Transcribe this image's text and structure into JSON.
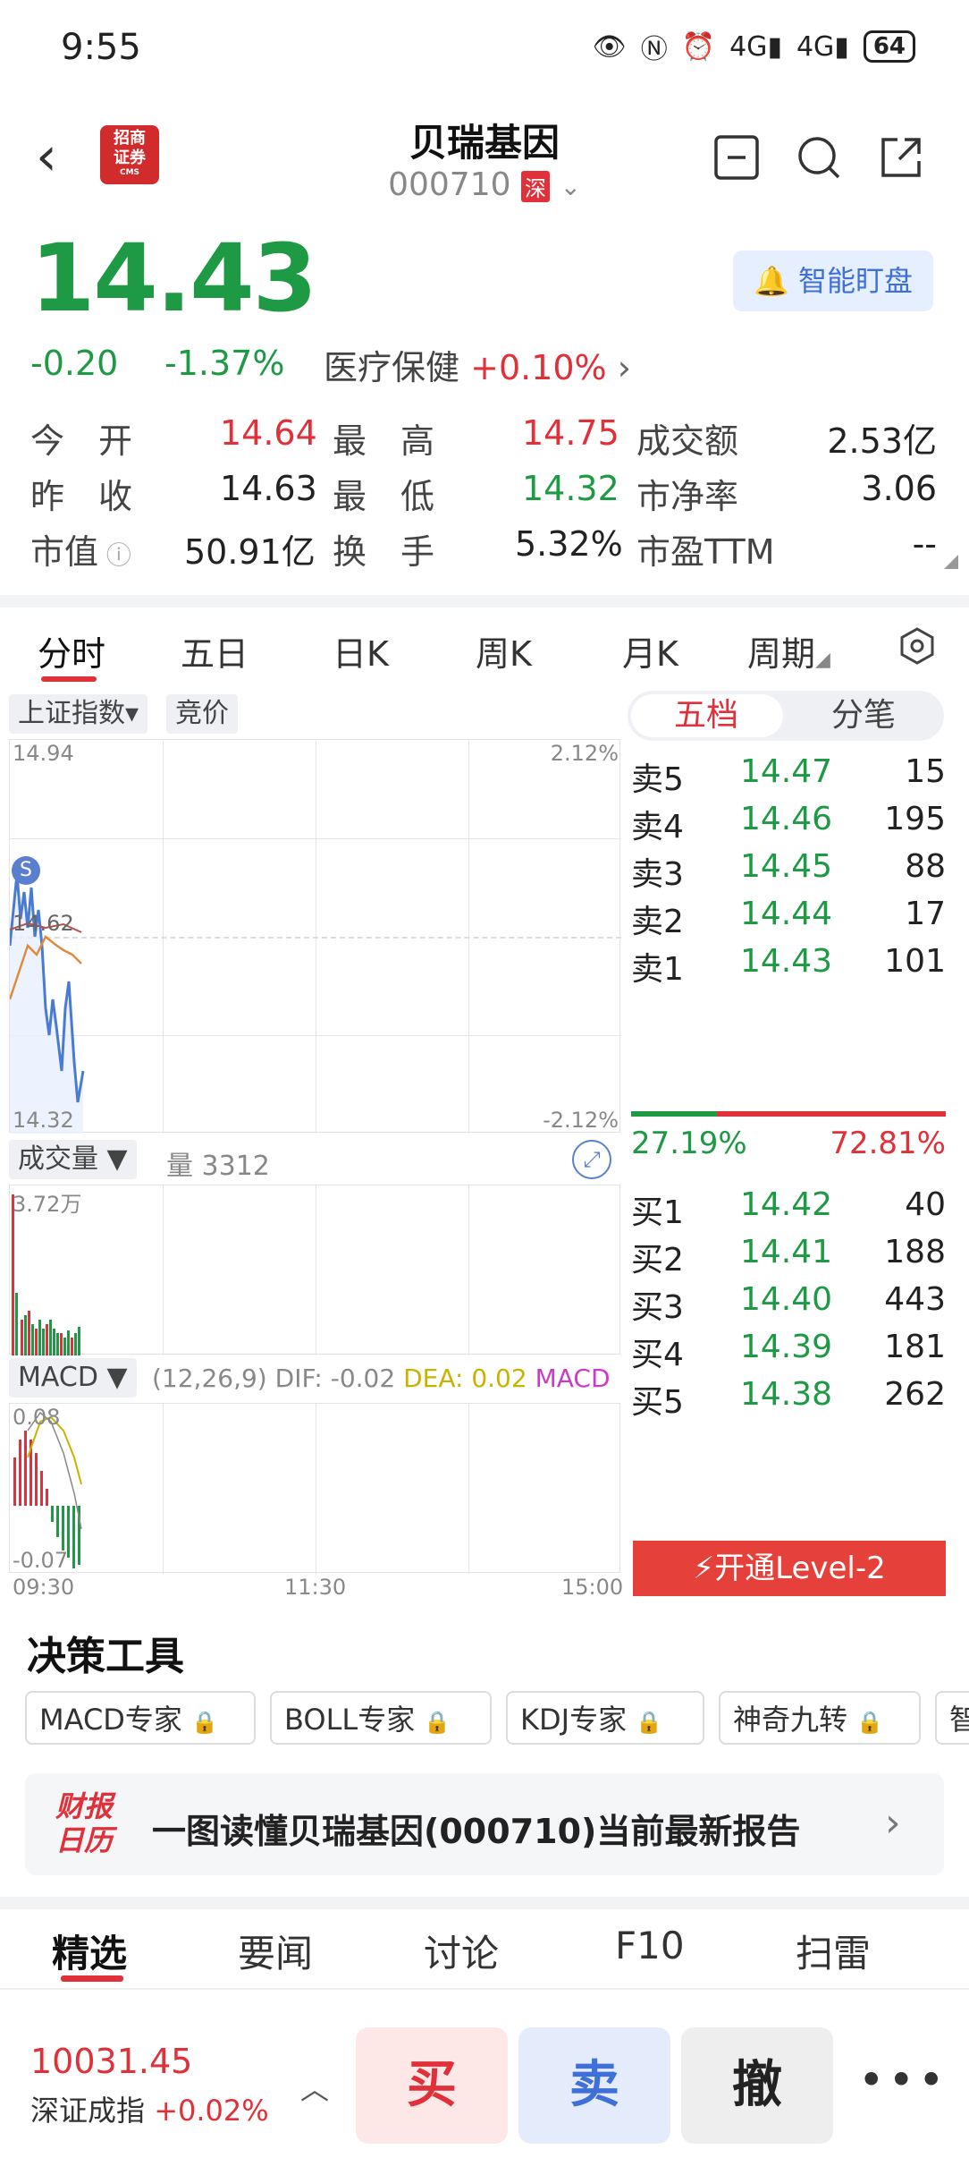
{
  "status_bar": {
    "time": "9:55",
    "net1": "4G",
    "net2": "4G",
    "battery": "64"
  },
  "header": {
    "logo_text": "招商证券",
    "logo_sub": "CMS",
    "stock_name": "贝瑞基因",
    "stock_code": "000710",
    "market_badge": "深"
  },
  "quote": {
    "price": "14.43",
    "change": "-0.20",
    "change_pct": "-1.37%",
    "sector": "医疗保健",
    "sector_pct": "+0.10%",
    "alert_label": "智能盯盘"
  },
  "stats": {
    "open_label": "今　开",
    "open": "14.64",
    "high_label": "最　高",
    "high": "14.75",
    "amount_label": "成交额",
    "amount": "2.53亿",
    "prev_label": "昨　收",
    "prev": "14.63",
    "low_label": "最　低",
    "low": "14.32",
    "pb_label": "市净率",
    "pb": "3.06",
    "mcap_label": "市值",
    "mcap": "50.91亿",
    "turnover_label": "换　手",
    "turnover": "5.32%",
    "pe_label": "市盈TTM",
    "pe": "--"
  },
  "tabs": [
    "分时",
    "五日",
    "日K",
    "周K",
    "月K",
    "周期"
  ],
  "chart": {
    "index_chip": "上证指数▾",
    "bid_chip": "竞价",
    "top_price": "14.94",
    "bottom_price": "14.32",
    "mid_price": "14.62",
    "top_pct": "2.12%",
    "bottom_pct": "-2.12%",
    "s_marker": "S",
    "volume_chip": "成交量 ▼",
    "volume_label": "量 3312",
    "volume_max": "3.72万",
    "macd_chip": "MACD ▼",
    "macd_params": "(12,26,9)",
    "dif": "DIF: -0.02",
    "dea": "DEA: 0.02",
    "macd_label": "MACD",
    "macd_top": "0.08",
    "macd_bottom": "-0.07",
    "time_start": "09:30",
    "time_mid": "11:30",
    "time_end": "15:00"
  },
  "orderbook": {
    "tab_active": "五档",
    "tab_other": "分笔",
    "asks": [
      {
        "label": "卖5",
        "price": "14.47",
        "vol": "15"
      },
      {
        "label": "卖4",
        "price": "14.46",
        "vol": "195"
      },
      {
        "label": "卖3",
        "price": "14.45",
        "vol": "88"
      },
      {
        "label": "卖2",
        "price": "14.44",
        "vol": "17"
      },
      {
        "label": "卖1",
        "price": "14.43",
        "vol": "101"
      }
    ],
    "buy_ratio": "27.19%",
    "sell_ratio": "72.81%",
    "buy_ratio_value": 0.2719,
    "bids": [
      {
        "label": "买1",
        "price": "14.42",
        "vol": "40"
      },
      {
        "label": "买2",
        "price": "14.41",
        "vol": "188"
      },
      {
        "label": "买3",
        "price": "14.40",
        "vol": "443"
      },
      {
        "label": "买4",
        "price": "14.39",
        "vol": "181"
      },
      {
        "label": "买5",
        "price": "14.38",
        "vol": "262"
      }
    ],
    "level2_label": "开通Level-2"
  },
  "tools": {
    "title": "决策工具",
    "items": [
      "MACD专家",
      "BOLL专家",
      "KDJ专家",
      "神奇九转",
      "智"
    ]
  },
  "report": {
    "logo_line1": "财报",
    "logo_line2": "日历",
    "text": "一图读懂贝瑞基因(000710)当前最新报告"
  },
  "bottom_tabs": [
    "精选",
    "要闻",
    "讨论",
    "F10",
    "扫雷"
  ],
  "bottom_bar": {
    "index_value": "10031.45",
    "index_name": "深证成指",
    "index_pct": "+0.02%",
    "buy": "买",
    "sell": "卖",
    "cancel": "撤"
  },
  "colors": {
    "up": "#e0303a",
    "down": "#1e9a45",
    "accent_blue": "#3f6fd8"
  }
}
